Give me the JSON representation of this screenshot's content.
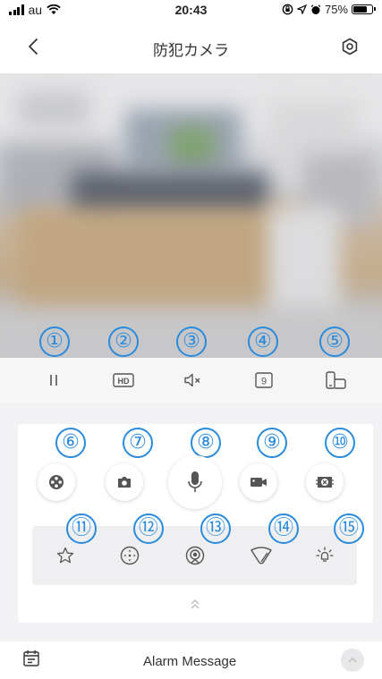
{
  "status_bar": {
    "carrier": "au",
    "time": "20:43",
    "battery_text": "75%",
    "battery_level": 0.75
  },
  "header": {
    "title": "防犯カメラ",
    "back_icon": "chevron-left-icon",
    "settings_icon": "gear-icon"
  },
  "annotations": [
    "①",
    "②",
    "③",
    "④",
    "⑤",
    "⑥",
    "⑦",
    "⑧",
    "⑨",
    "⑩",
    "⑪",
    "⑫",
    "⑬",
    "⑭",
    "⑮"
  ],
  "toolbar": {
    "quality_label": "HD",
    "split_label": "9",
    "items": [
      "pause-icon",
      "hd-icon",
      "mute-icon",
      "split-screen-icon",
      "fullscreen-icon"
    ]
  },
  "controls": {
    "buttons": [
      "film-reel-icon",
      "camera-icon",
      "microphone-icon",
      "video-camera-icon",
      "close-screen-icon"
    ]
  },
  "ptz": {
    "items": [
      "star-icon",
      "ptz-direction-icon",
      "motion-track-icon",
      "wiper-icon",
      "light-icon"
    ]
  },
  "alarm": {
    "label": "Alarm Message"
  },
  "colors": {
    "annotation": "#2a8bdc",
    "icon": "#555555",
    "background": "#f2f2f4"
  }
}
